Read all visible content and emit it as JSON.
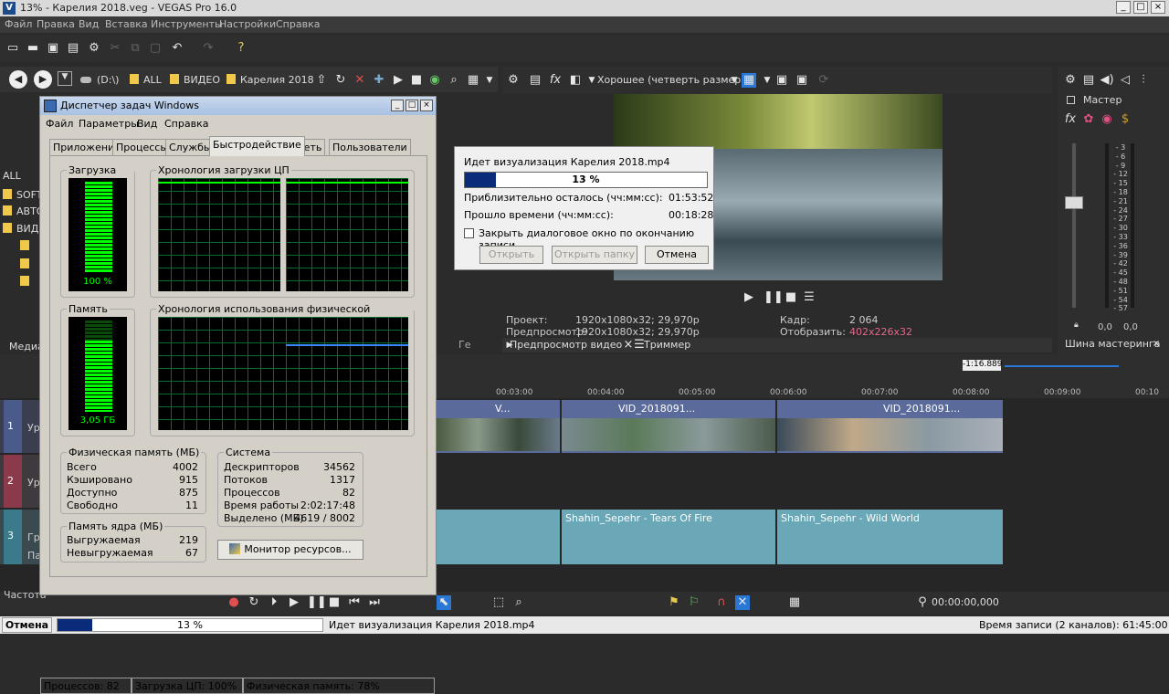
{
  "app": {
    "title": "13% - Карелия 2018.veg - VEGAS Pro 16.0",
    "menu": [
      "Файл",
      "Правка",
      "Вид",
      "Вставка",
      "Инструменты",
      "Настройки",
      "Справка"
    ]
  },
  "explorer": {
    "drive": "(D:\\)",
    "crumbs": [
      "ALL",
      "ВИДЕО",
      "Карелия 2018"
    ],
    "tree_items": [
      "ALL",
      "SOFT",
      "АВТО",
      "ВИД"
    ],
    "tab_media": "Медиа",
    "tab_generic": "Ге"
  },
  "taskmgr": {
    "title": "Диспетчер задач Windows",
    "menu": [
      "Файл",
      "Параметры",
      "Вид",
      "Справка"
    ],
    "tabs": [
      "Приложения",
      "Процессы",
      "Службы",
      "Быстродействие",
      "Сеть",
      "Пользователи"
    ],
    "active_tab": "Быстродействие",
    "cpu_label": "Загрузка ЦП",
    "cpu_value": "100 %",
    "cpu_history_label": "Хронология загрузки ЦП",
    "mem_label": "Память",
    "mem_value": "3,05 ГБ",
    "mem_history_label": "Хронология использования физической памяти",
    "physical": {
      "label": "Физическая память (МБ)",
      "rows": [
        {
          "k": "Всего",
          "v": "4002"
        },
        {
          "k": "Кэшировано",
          "v": "915"
        },
        {
          "k": "Доступно",
          "v": "875"
        },
        {
          "k": "Свободно",
          "v": "11"
        }
      ]
    },
    "kernel": {
      "label": "Память ядра (МБ)",
      "rows": [
        {
          "k": "Выгружаемая",
          "v": "219"
        },
        {
          "k": "Невыгружаемая",
          "v": "67"
        }
      ]
    },
    "system": {
      "label": "Система",
      "rows": [
        {
          "k": "Дескрипторов",
          "v": "34562"
        },
        {
          "k": "Потоков",
          "v": "1317"
        },
        {
          "k": "Процессов",
          "v": "82"
        },
        {
          "k": "Время работы",
          "v": "2:02:17:48"
        },
        {
          "k": "Выделено (МБ)",
          "v": "4619 / 8002"
        }
      ]
    },
    "resource_button": "Монитор ресурсов...",
    "status": [
      "Процессов: 82",
      "Загрузка ЦП: 100%",
      "Физическая память: 78%"
    ],
    "cpu_fraction": 1.0,
    "mem_fraction": 0.78
  },
  "render": {
    "title": "Идет визуализация Карелия 2018.mp4",
    "percent": "13 %",
    "progress": 0.13,
    "remaining_label": "Приблизительно осталось (чч:мм:сс):",
    "remaining_value": "01:53:52",
    "elapsed_label": "Прошло времени (чч:мм:сс):",
    "elapsed_value": "00:18:28",
    "checkbox_label": "Закрыть диалоговое окно по окончанию записи",
    "btn_open": "Открыть",
    "btn_open_folder": "Открыть папку",
    "btn_cancel": "Отмена"
  },
  "preview": {
    "quality": "Хорошее (четверть размера)",
    "project_label": "Проект:",
    "project_value": "1920x1080x32; 29,970p",
    "preview_label": "Предпросмотр:",
    "preview_value": "1920x1080x32; 29,970p",
    "frame_label": "Кадр:",
    "frame_value": "2 064",
    "display_label": "Отобразить:",
    "display_value": "402x226x32",
    "tab_preview": "Предпросмотр видео",
    "tab_trimmer": "Триммер"
  },
  "master": {
    "label": "Мастер",
    "scale": [
      "3",
      "6",
      "9",
      "12",
      "15",
      "18",
      "21",
      "24",
      "27",
      "30",
      "33",
      "36",
      "39",
      "42",
      "45",
      "48",
      "51",
      "54",
      "57"
    ],
    "zero_l": "0,0",
    "zero_r": "0,0",
    "bus_label": "Шина мастеринга"
  },
  "timeline": {
    "cursor_time": "-1:16.889",
    "ruler": [
      "00:03:00",
      "00:04:00",
      "00:05:00",
      "00:06:00",
      "00:07:00",
      "00:08:00",
      "00:09:00",
      "00:10"
    ],
    "video_clips": [
      "V...",
      "VID_2018091...",
      "VID_2018091..."
    ],
    "audio_clips": [
      "Shahin_Sepehr - Tears Of Fire",
      "Shahin_Sepehr - Wild World"
    ],
    "track_labels": [
      "Ур",
      "Ур",
      "Гр",
      "Па"
    ],
    "track_nums": [
      "1",
      "2",
      "3"
    ],
    "timecode": "00:00:00,000",
    "rate_label": "Частота"
  },
  "footer": {
    "cancel": "Отмена",
    "percent": "13 %",
    "progress": 0.13,
    "text": "Идет визуализация Карелия 2018.mp4",
    "record_time": "Время записи (2 каналов): 61:45:00"
  },
  "colors": {
    "accent": "#2a78d6",
    "meter_green": "#00ff00",
    "clip_video": "#5a6a9a",
    "clip_audio": "#6aa8b8",
    "display_value": "#e06a8a"
  }
}
